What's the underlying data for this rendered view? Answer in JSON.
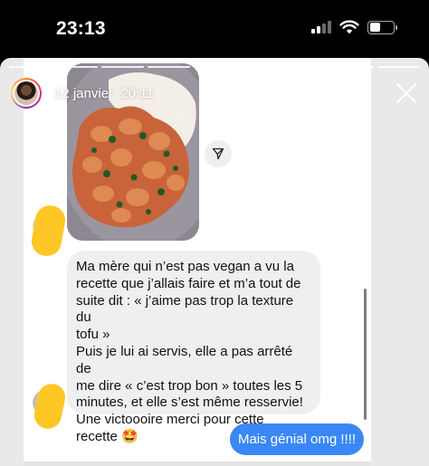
{
  "status_bar": {
    "time": "23:13",
    "icons": [
      "signal-icon",
      "wifi-icon",
      "battery-icon"
    ]
  },
  "story": {
    "date": "12 janvier",
    "time": "20:11",
    "close_icon": "close-icon"
  },
  "chat": {
    "photo": {
      "alt_icon": "food-photo",
      "share_icon": "send-icon"
    },
    "received_message": [
      "Ma mère qui n’est pas vegan a vu la",
      "recette que j’allais faire et m’a tout de",
      "suite dit : « j’aime pas trop la texture du",
      "tofu »",
      "Puis je lui ai servis, elle a pas arrêté de",
      "me dire « c’est trop bon » toutes les 5",
      "minutes, et elle s’est même resservie!",
      "Une victoooire merci pour cette",
      "recette 🤩"
    ],
    "sent_message": "Mais génial omg !!!!"
  },
  "colors": {
    "sent_bubble": "#3a87f6",
    "received_bubble": "#efefef",
    "redaction": "#ffc726"
  }
}
